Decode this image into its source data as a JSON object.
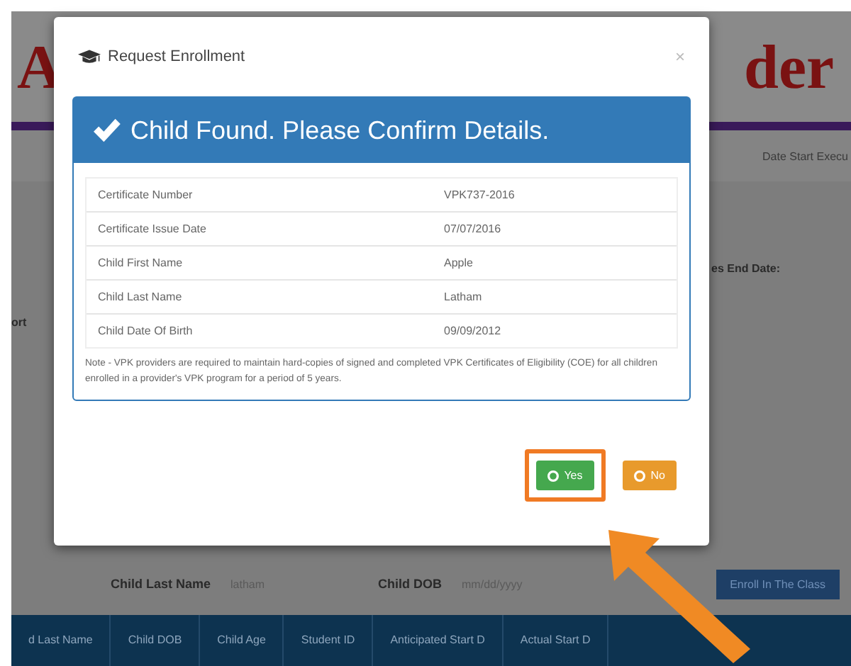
{
  "page": {
    "logo_left": "A",
    "logo_right": "der",
    "subnav_text": "Date Start Execu",
    "end_date_label": "es End Date:",
    "side_label": "ort",
    "filters": [
      {
        "label": "Child Last Name",
        "placeholder": "latham"
      },
      {
        "label": "Child DOB",
        "placeholder": "mm/dd/yyyy"
      }
    ],
    "enroll_button": "Enroll In The Class",
    "table": {
      "columns": [
        "d Last Name",
        "Child DOB",
        "Child Age",
        "Student ID",
        "Anticipated Start D",
        "Actual Start D"
      ]
    }
  },
  "modal": {
    "title": "Request Enrollment",
    "close": "×",
    "banner": "Child Found. Please Confirm Details.",
    "details": [
      {
        "label": "Certificate Number",
        "value": "VPK737-2016"
      },
      {
        "label": "Certificate Issue Date",
        "value": "07/07/2016"
      },
      {
        "label": "Child First Name",
        "value": "Apple"
      },
      {
        "label": "Child Last Name",
        "value": "Latham"
      },
      {
        "label": "Child Date Of Birth",
        "value": "09/09/2012"
      }
    ],
    "note": "Note - VPK providers are required to maintain hard-copies of signed and completed VPK Certificates of Eligibility (COE) for all children enrolled in a provider's VPK program for a period of 5 years.",
    "buttons": [
      {
        "kind": "yes",
        "label": "Yes",
        "highlighted": true
      },
      {
        "kind": "no",
        "label": "No",
        "highlighted": false
      }
    ]
  }
}
